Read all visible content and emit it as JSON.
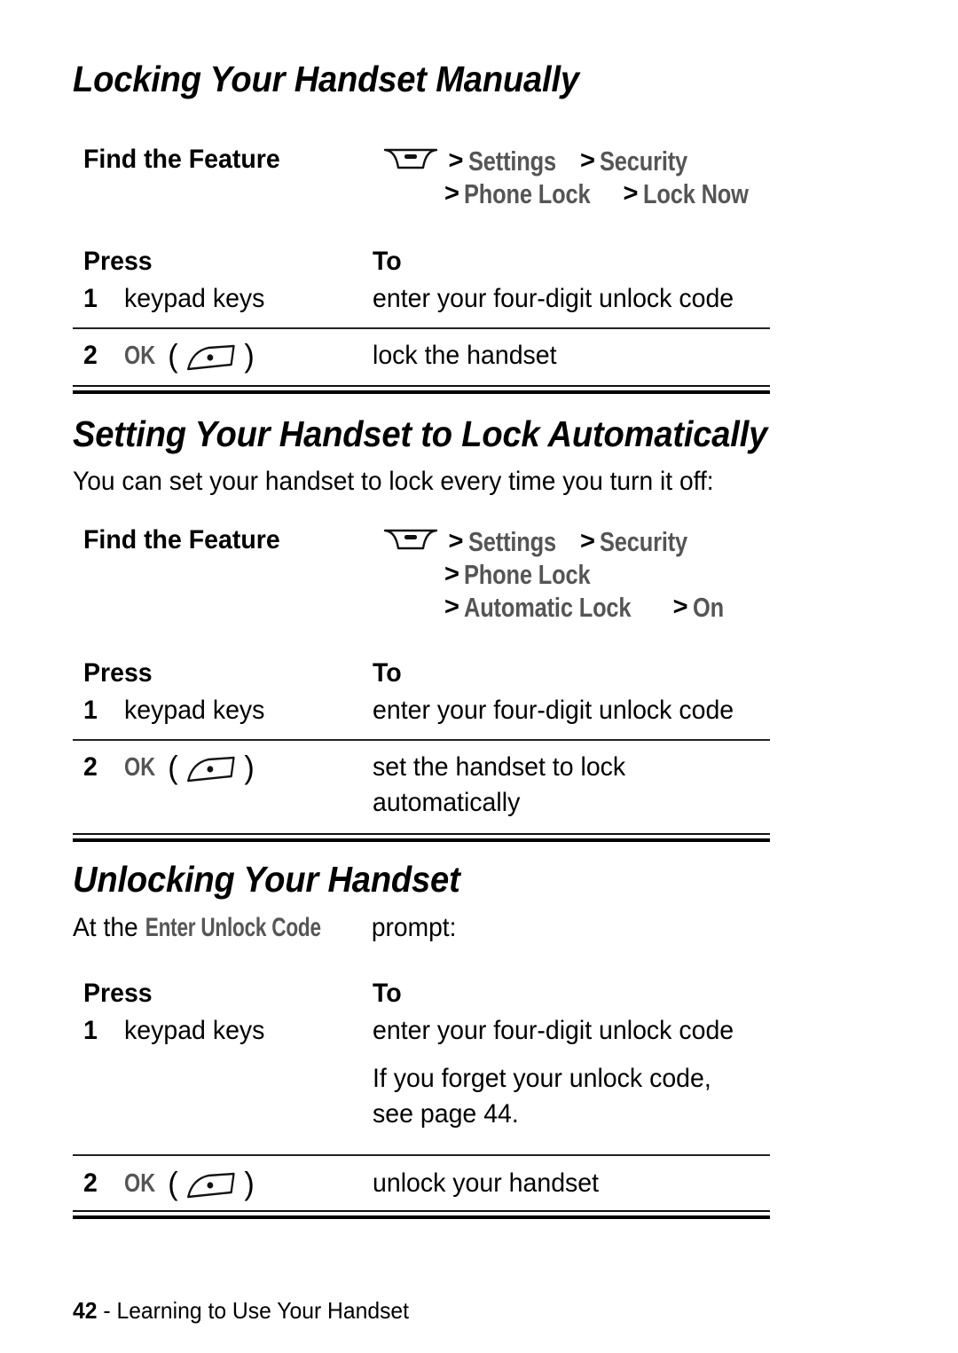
{
  "document": {
    "page_number": "42",
    "footer_separator": "-",
    "footer_section": "Learning to Use Your Handset"
  },
  "icons": {
    "menu_key": "menu-key-icon",
    "ok_key": "ok-key-icon",
    "separator": ">"
  },
  "colors": {
    "text": "#000000",
    "display_text": "#555555",
    "rule": "#000000",
    "background": "#ffffff"
  },
  "sections": [
    {
      "id": "locking-manually",
      "title": "Locking Your Handset Manually",
      "intro": null,
      "find_the_feature": {
        "label": "Find the Feature",
        "path_lines": [
          {
            "icon": "menu-key-icon",
            "items": [
              "Settings",
              "Security"
            ]
          },
          {
            "icon": null,
            "items": [
              "Phone Lock",
              "Lock Now"
            ]
          }
        ]
      },
      "table": {
        "headers": {
          "press": "Press",
          "to": "To"
        },
        "rows": [
          {
            "num": "1",
            "key_text": "keypad keys",
            "key_label": null,
            "key_icon": null,
            "desc": [
              "enter your four-digit unlock code"
            ]
          },
          {
            "num": "2",
            "key_text": null,
            "key_label": "OK",
            "key_icon": "ok-key-icon",
            "desc": [
              "lock the handset"
            ]
          }
        ]
      }
    },
    {
      "id": "lock-automatically",
      "title": "Setting Your Handset to Lock Automatically",
      "intro": "You can set your handset to lock every time you turn it off:",
      "find_the_feature": {
        "label": "Find the Feature",
        "path_lines": [
          {
            "icon": "menu-key-icon",
            "items": [
              "Settings",
              "Security"
            ]
          },
          {
            "icon": null,
            "items": [
              "Phone Lock"
            ]
          },
          {
            "icon": null,
            "items": [
              "Automatic Lock",
              "On"
            ]
          }
        ]
      },
      "table": {
        "headers": {
          "press": "Press",
          "to": "To"
        },
        "rows": [
          {
            "num": "1",
            "key_text": "keypad keys",
            "key_label": null,
            "key_icon": null,
            "desc": [
              "enter your four-digit unlock code"
            ]
          },
          {
            "num": "2",
            "key_text": null,
            "key_label": "OK",
            "key_icon": "ok-key-icon",
            "desc": [
              "set the handset to lock",
              "automatically"
            ]
          }
        ]
      }
    },
    {
      "id": "unlocking",
      "title": "Unlocking Your Handset",
      "intro_parts": {
        "before": "At the ",
        "display": "Enter Unlock Code",
        "after": " prompt:"
      },
      "find_the_feature": null,
      "table": {
        "headers": {
          "press": "Press",
          "to": "To"
        },
        "rows": [
          {
            "num": "1",
            "key_text": "keypad keys",
            "key_label": null,
            "key_icon": null,
            "desc": [
              "enter your four-digit unlock code"
            ],
            "desc_extra": [
              "If you forget your unlock code,",
              "see page 44."
            ]
          },
          {
            "num": "2",
            "key_text": null,
            "key_label": "OK",
            "key_icon": "ok-key-icon",
            "desc": [
              "unlock your handset"
            ]
          }
        ]
      }
    }
  ]
}
